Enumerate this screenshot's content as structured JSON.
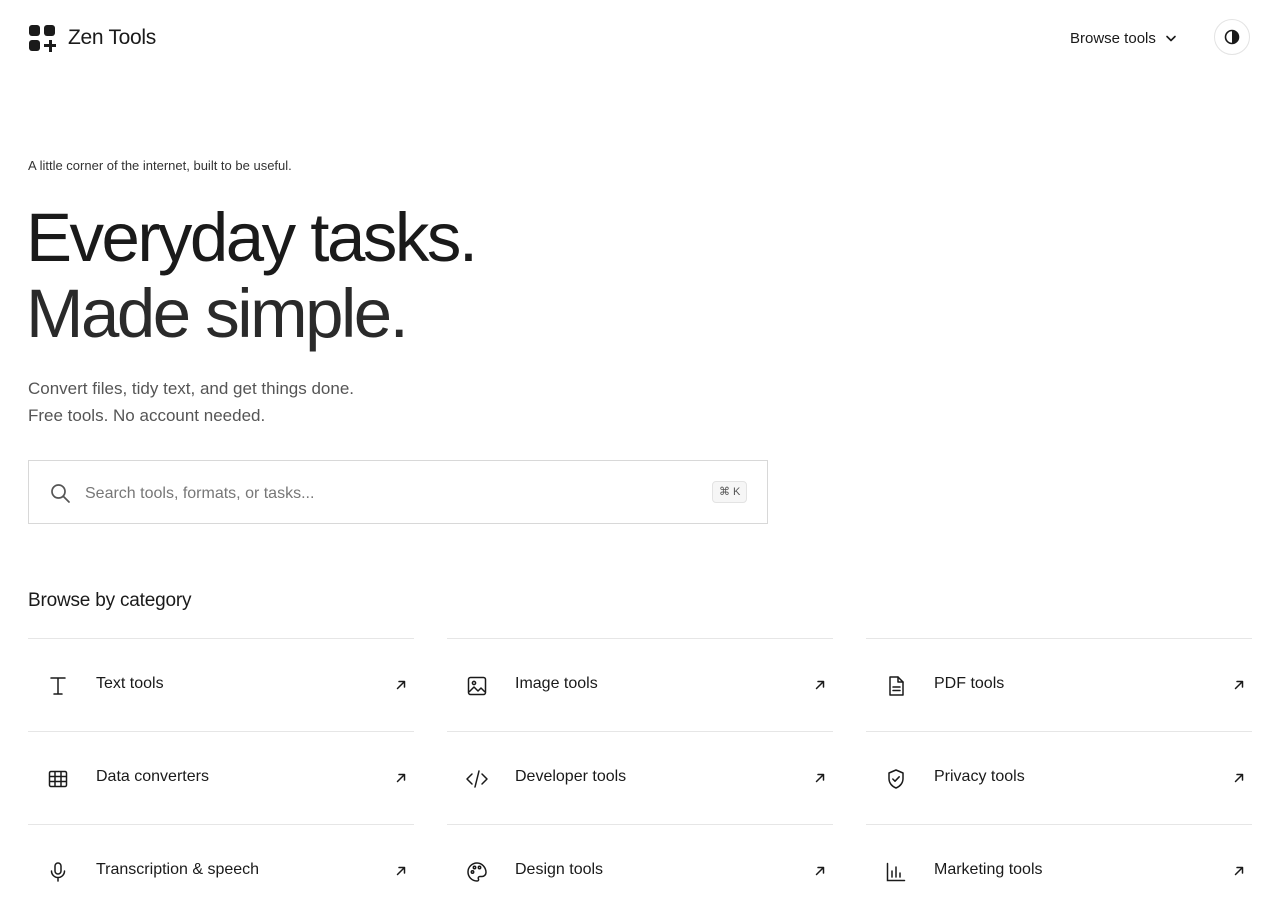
{
  "brand": {
    "name": "Zen Tools"
  },
  "nav": {
    "browse_label": "Browse tools"
  },
  "hero": {
    "eyebrow": "A little corner of the internet, built to be useful.",
    "headline_line1": "Everyday tasks.",
    "headline_line2": "Made simple.",
    "sub_line1": "Convert files, tidy text, and get things done.",
    "sub_line2": "Free tools. No account needed."
  },
  "search": {
    "placeholder": "Search tools, formats, or tasks...",
    "shortcut": "⌘ K"
  },
  "categories": {
    "title": "Browse by category",
    "items": [
      {
        "label": "Text tools",
        "icon": "text-cursor-icon"
      },
      {
        "label": "Image tools",
        "icon": "image-icon"
      },
      {
        "label": "PDF tools",
        "icon": "document-icon"
      },
      {
        "label": "Data converters",
        "icon": "table-icon"
      },
      {
        "label": "Developer tools",
        "icon": "code-icon"
      },
      {
        "label": "Privacy tools",
        "icon": "shield-check-icon"
      },
      {
        "label": "Transcription & speech",
        "icon": "microphone-icon"
      },
      {
        "label": "Design tools",
        "icon": "palette-icon"
      },
      {
        "label": "Marketing tools",
        "icon": "bar-chart-icon"
      }
    ]
  }
}
